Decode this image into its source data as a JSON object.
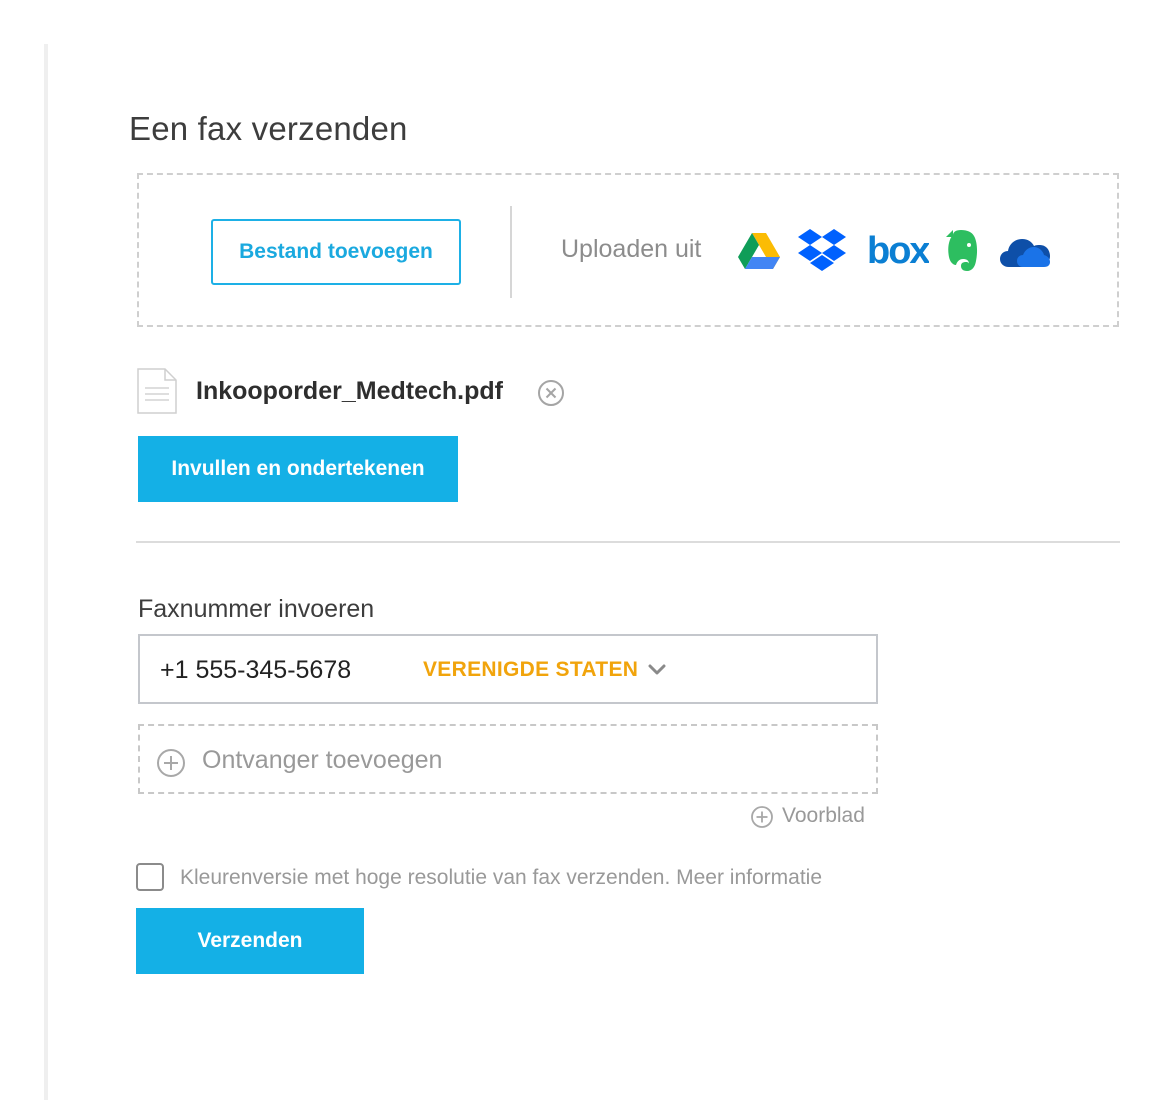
{
  "page": {
    "title": "Een fax verzenden"
  },
  "upload": {
    "add_file_label": "Bestand toevoegen",
    "upload_from_label": "Uploaden uit",
    "services": [
      "google-drive",
      "dropbox",
      "box",
      "evernote",
      "onedrive"
    ],
    "box_wordmark": "box"
  },
  "file": {
    "name": "Inkooporder_Medtech.pdf",
    "fill_sign_label": "Invullen en ondertekenen"
  },
  "fax": {
    "label": "Faxnummer invoeren",
    "number": "+1 555-345-5678",
    "country": "VERENIGDE STATEN",
    "add_recipient_label": "Ontvanger toevoegen",
    "cover_label": "Voorblad"
  },
  "options": {
    "hires_label": "Kleurenversie met hoge resolutie van fax verzenden.",
    "more_info_link": "Meer informatie",
    "hires_checked": false
  },
  "actions": {
    "send_label": "Verzenden"
  },
  "colors": {
    "accent": "#14b0e6",
    "country_orange": "#f1a40c",
    "dropbox_blue": "#0061fe",
    "box_blue": "#0b7fd3",
    "evernote_green": "#2dbe60",
    "onedrive_blue": "#0e4fa8"
  }
}
